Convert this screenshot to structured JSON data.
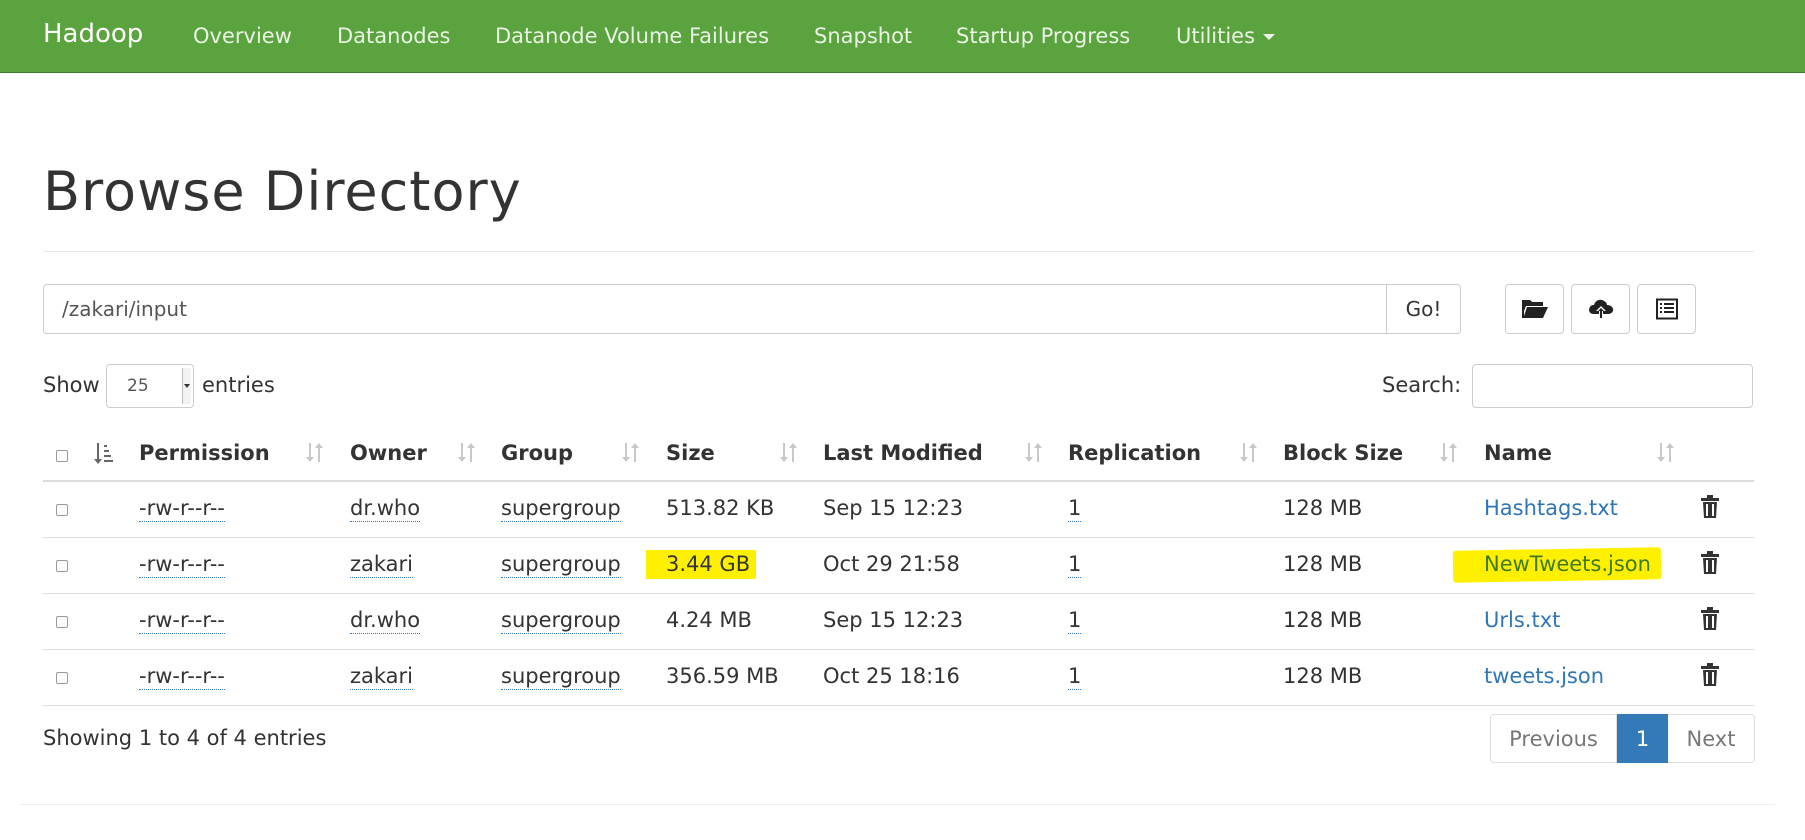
{
  "navbar": {
    "brand": "Hadoop",
    "items": [
      "Overview",
      "Datanodes",
      "Datanode Volume Failures",
      "Snapshot",
      "Startup Progress",
      "Utilities"
    ]
  },
  "page_title": "Browse Directory",
  "path_bar": {
    "value": "/zakari/input",
    "go_label": "Go!"
  },
  "toolbar": {
    "icons": [
      "folder-open-icon",
      "cloud-upload-icon",
      "list-alt-icon"
    ]
  },
  "table_controls": {
    "show_label": "Show",
    "entries_value": "25",
    "entries_label": "entries",
    "search_label": "Search:"
  },
  "table": {
    "columns": [
      "Permission",
      "Owner",
      "Group",
      "Size",
      "Last Modified",
      "Replication",
      "Block Size",
      "Name"
    ],
    "rows": [
      {
        "permission": "-rw-r--r--",
        "owner": "dr.who",
        "group": "supergroup",
        "size": "513.82 KB",
        "modified": "Sep 15 12:23",
        "replication": "1",
        "block_size": "128 MB",
        "name": "Hashtags.txt"
      },
      {
        "permission": "-rw-r--r--",
        "owner": "zakari",
        "group": "supergroup",
        "size": "3.44 GB",
        "modified": "Oct 29 21:58",
        "replication": "1",
        "block_size": "128 MB",
        "name": "NewTweets.json"
      },
      {
        "permission": "-rw-r--r--",
        "owner": "dr.who",
        "group": "supergroup",
        "size": "4.24 MB",
        "modified": "Sep 15 12:23",
        "replication": "1",
        "block_size": "128 MB",
        "name": "Urls.txt"
      },
      {
        "permission": "-rw-r--r--",
        "owner": "zakari",
        "group": "supergroup",
        "size": "356.59 MB",
        "modified": "Oct 25 18:16",
        "replication": "1",
        "block_size": "128 MB",
        "name": "tweets.json"
      }
    ],
    "highlight_color": "#fff000"
  },
  "footer": {
    "info": "Showing 1 to 4 of 4 entries",
    "pagination": {
      "previous": "Previous",
      "current": "1",
      "next": "Next"
    }
  },
  "colors": {
    "navbar": "#5aa33f",
    "link": "#2f76b5",
    "active_page": "#337ab7"
  }
}
